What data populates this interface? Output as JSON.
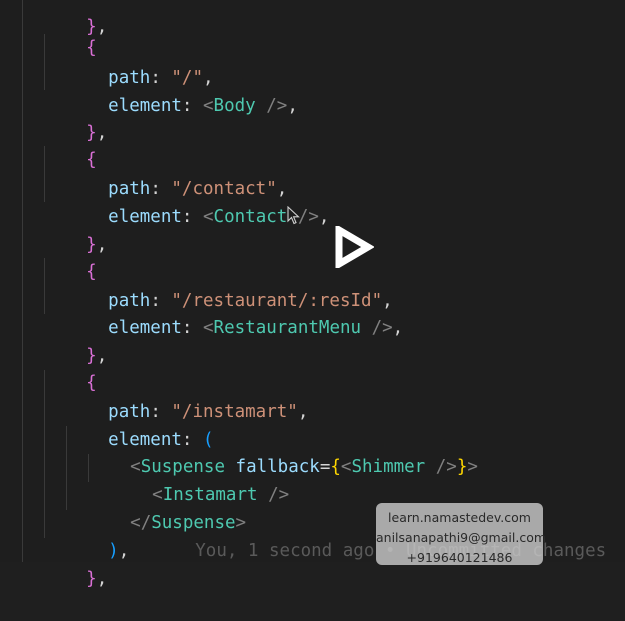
{
  "code": {
    "l0": {
      "brace": "}",
      "comma": ","
    },
    "l1": {
      "brace": "{"
    },
    "l2": {
      "key": "path",
      "colon": ": ",
      "value": "\"/\"",
      "comma": ","
    },
    "l3": {
      "key": "element",
      "colon": ": ",
      "open": "<",
      "tag": "Body",
      "close": " />",
      "comma": ","
    },
    "l4": {
      "brace": "}",
      "comma": ","
    },
    "l5": {
      "brace": "{"
    },
    "l6": {
      "key": "path",
      "colon": ": ",
      "value": "\"/contact\"",
      "comma": ","
    },
    "l7": {
      "key": "element",
      "colon": ": ",
      "open": "<",
      "tag": "Contact",
      "close": " />",
      "comma": ","
    },
    "l8": {
      "brace": "}",
      "comma": ","
    },
    "l9": {
      "brace": "{"
    },
    "l10": {
      "key": "path",
      "colon": ": ",
      "value": "\"/restaurant/:resId\"",
      "comma": ","
    },
    "l11": {
      "key": "element",
      "colon": ": ",
      "open": "<",
      "tag": "RestaurantMenu",
      "close": " />",
      "comma": ","
    },
    "l12": {
      "brace": "}",
      "comma": ","
    },
    "l13": {
      "brace": "{"
    },
    "l14": {
      "key": "path",
      "colon": ": ",
      "value": "\"/instamart\"",
      "comma": ","
    },
    "l15": {
      "key": "element",
      "colon": ": ",
      "paren": "("
    },
    "l16": {
      "open": "<",
      "tag": "Suspense",
      "attr": " fallback",
      "eq": "=",
      "lbrace": "{",
      "inner_open": "<",
      "inner_tag": "Shimmer",
      "inner_close": " />",
      "rbrace": "}",
      "end": ">"
    },
    "l17": {
      "open": "<",
      "tag": "Instamart",
      "close": " />"
    },
    "l18": {
      "open": "</",
      "tag": "Suspense",
      "end": ">"
    },
    "l19": {
      "paren": ")",
      "comma": ",",
      "blame": "You, 1 second ago • Uncommitted changes"
    },
    "l20": {
      "brace": "}",
      "comma": ","
    }
  },
  "watermark": {
    "site": "learn.namastedev.com",
    "email": "anilsanapathi9@gmail.com",
    "phone": "+919640121486"
  },
  "colors": {
    "background": "#1e1e1e",
    "property": "#9cdcfe",
    "string": "#ce9178",
    "component": "#4ec9b0",
    "bracket_purple": "#da70d6",
    "bracket_yellow": "#ffd700"
  }
}
